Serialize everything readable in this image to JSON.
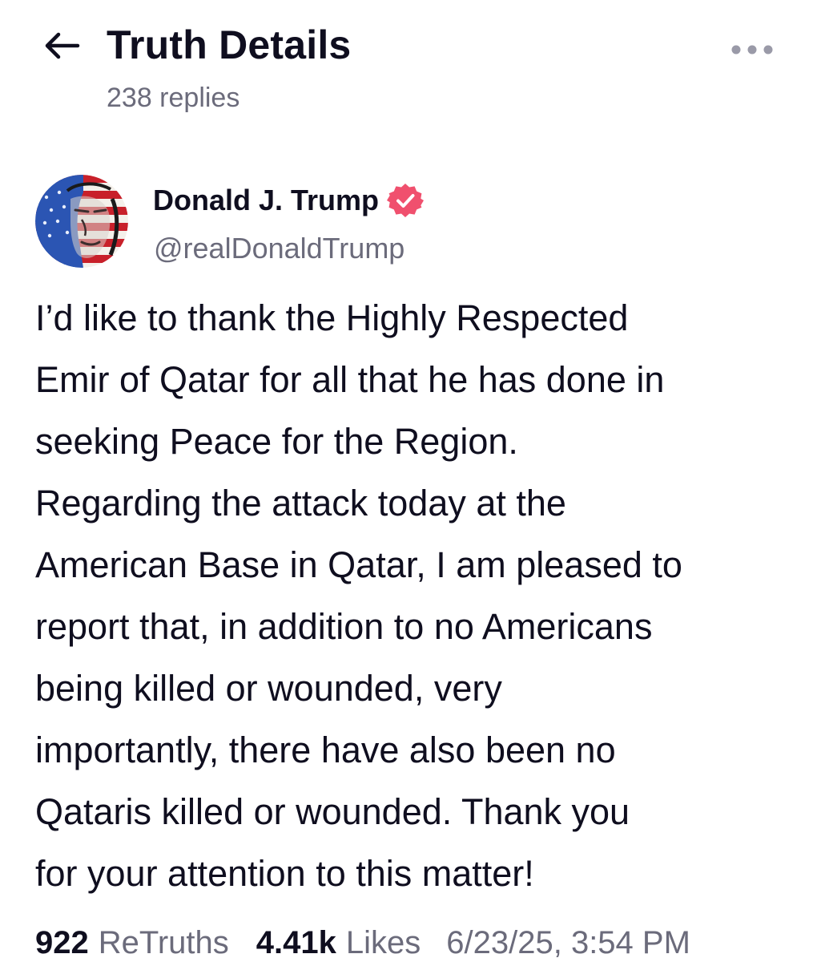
{
  "header": {
    "title": "Truth Details",
    "replies": "238 replies",
    "back_icon": "arrow-left-icon",
    "more_icon": "more-horizontal-icon"
  },
  "author": {
    "name": "Donald J. Trump",
    "handle": "@realDonaldTrump",
    "verified": true,
    "verified_color": "#f0506e",
    "avatar_icon": "avatar-flag-portrait"
  },
  "post": {
    "lines": [
      "I’d like to thank the Highly Respected",
      "Emir of Qatar for all that he has done in",
      "seeking Peace for the Region.",
      "Regarding the attack today at the",
      "American Base in Qatar, I am pleased to",
      "report that, in addition to no Americans",
      "being killed or wounded, very",
      "importantly, there have also been no",
      "Qataris killed or wounded. Thank you",
      "for your attention to this matter!"
    ]
  },
  "stats": {
    "retruths_count": "922",
    "retruths_label": "ReTruths",
    "likes_count": "4.41k",
    "likes_label": "Likes",
    "timestamp": "6/23/25, 3:54 PM"
  },
  "colors": {
    "text_primary": "#0f0e1f",
    "text_secondary": "#6b6b7b",
    "verified_badge": "#f0506e"
  }
}
